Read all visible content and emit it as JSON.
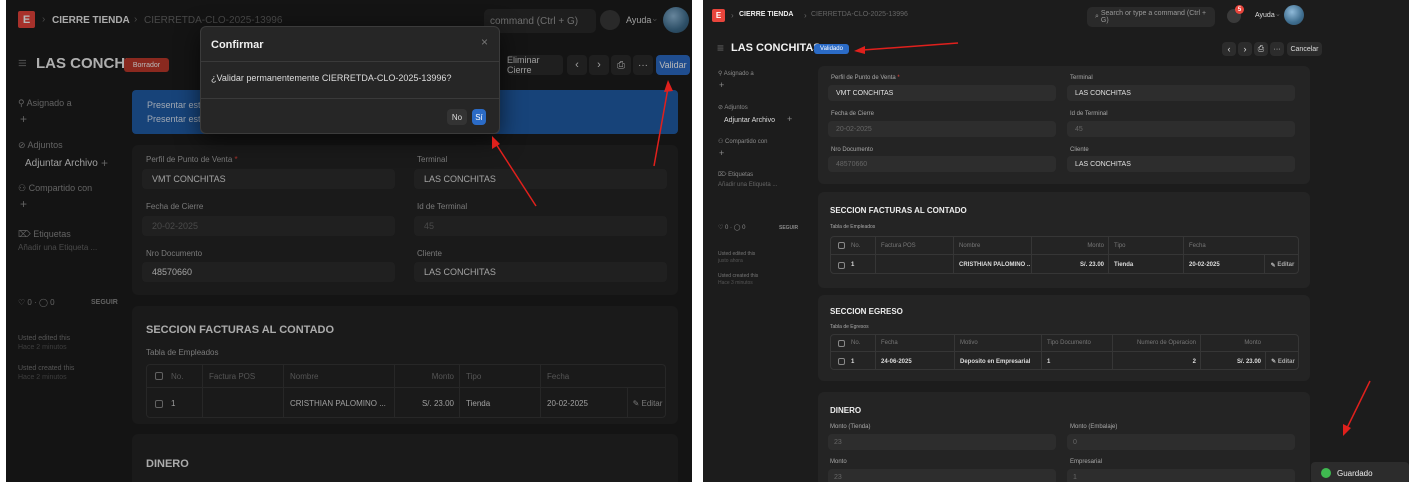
{
  "left": {
    "breadcrumb": {
      "module": "CIERRE TIENDA",
      "doc": "CIERRETDA-CLO-2025-13996"
    },
    "search_tail": "command (Ctrl + G)",
    "help": "Ayuda",
    "title": "LAS CONCHITAS",
    "status": "Borrador",
    "btn_eliminar": "Eliminar Cierre",
    "btn_validar": "Validar",
    "banner": {
      "line1": "Presentar este d",
      "line2": "Presentar este d"
    },
    "sidebar": {
      "assigned": "Asignado a",
      "attachments": "Adjuntos",
      "attach_btn": "Adjuntar Archivo",
      "shared": "Compartido con",
      "tags": "Etiquetas",
      "add_tag": "Añadir una Etiqueta ...",
      "likes": "0",
      "comments": "0",
      "follow": "SEGUIR",
      "activity1": "Usted edited this",
      "activity1_time": "Hace 2 minutos",
      "activity2": "Usted created this",
      "activity2_time": "Hace 2 minutos"
    },
    "fields": {
      "pdv_label": "Perfil de Punto de Venta",
      "pdv_value": "VMT CONCHITAS",
      "terminal_label": "Terminal",
      "terminal_value": "LAS CONCHITAS",
      "fecha_label": "Fecha de Cierre",
      "fecha_value": "20-02-2025",
      "idterm_label": "Id de Terminal",
      "idterm_value": "45",
      "nro_label": "Nro Documento",
      "nro_value": "48570660",
      "cliente_label": "Cliente",
      "cliente_value": "LAS CONCHITAS"
    },
    "section_facturas": "SECCION FACTURAS AL CONTADO",
    "tabla_empleados": "Tabla de Empleados",
    "table": {
      "headers": [
        "No.",
        "Factura POS",
        "Nombre",
        "Monto",
        "Tipo",
        "Fecha"
      ],
      "row": {
        "no": "1",
        "factura": "",
        "nombre": "CRISTHIAN PALOMINO ...",
        "monto": "S/. 23.00",
        "tipo": "Tienda",
        "fecha": "20-02-2025",
        "edit": "Editar"
      }
    },
    "section_dinero": "DINERO",
    "modal": {
      "title": "Confirmar",
      "message": "¿Validar permanentemente CIERRETDA-CLO-2025-13996?",
      "no": "No",
      "yes": "Sí",
      "close": "×"
    }
  },
  "right": {
    "breadcrumb": {
      "module": "CIERRE TIENDA",
      "doc": "CIERRETDA-CLO-2025-13996"
    },
    "search": "Search or type a command (Ctrl + G)",
    "notif_count": "5",
    "help": "Ayuda",
    "title": "LAS CONCHITAS",
    "status": "Validado",
    "btn_cancel": "Cancelar",
    "sidebar": {
      "assigned": "Asignado a",
      "attachments": "Adjuntos",
      "attach_btn": "Adjuntar Archivo",
      "shared": "Compartido con",
      "tags": "Etiquetas",
      "add_tag": "Añadir una Etiqueta ...",
      "likes": "0",
      "comments": "0",
      "follow": "SEGUIR",
      "activity1": "Usted edited this",
      "activity1_time": "justo ahora",
      "activity2": "Usted created this",
      "activity2_time": "Hace 3 minutos"
    },
    "fields": {
      "pdv_label": "Perfil de Punto de Venta",
      "pdv_value": "VMT CONCHITAS",
      "terminal_label": "Terminal",
      "terminal_value": "LAS CONCHITAS",
      "fecha_label": "Fecha de Cierre",
      "fecha_value": "20-02-2025",
      "idterm_label": "Id de Terminal",
      "idterm_value": "45",
      "nro_label": "Nro Documento",
      "nro_value": "48570660",
      "cliente_label": "Cliente",
      "cliente_value": "LAS CONCHITAS"
    },
    "section_facturas": "SECCION FACTURAS AL CONTADO",
    "tabla_empleados": "Tabla de Empleados",
    "table1": {
      "headers": [
        "No.",
        "Factura POS",
        "Nombre",
        "Monto",
        "Tipo",
        "Fecha"
      ],
      "row": {
        "no": "1",
        "factura": "",
        "nombre": "CRISTHIAN PALOMINO ...",
        "monto": "S/. 23.00",
        "tipo": "Tienda",
        "fecha": "20-02-2025",
        "edit": "Editar"
      }
    },
    "section_egreso": "SECCION EGRESO",
    "tabla_egresos": "Tabla de Egresos",
    "table2": {
      "headers": [
        "No.",
        "Fecha",
        "Motivo",
        "Tipo Documento",
        "Numero de Operacion",
        "Monto"
      ],
      "row": {
        "no": "1",
        "fecha": "24-06-2025",
        "motivo": "Deposito en Empresarial",
        "tipo": "1",
        "numero": "2",
        "monto": "S/. 23.00",
        "edit": "Editar"
      }
    },
    "section_dinero": "DINERO",
    "dinero": {
      "monto_tienda_label": "Monto (Tienda)",
      "monto_tienda_value": "23",
      "monto_embalaje_label": "Monto (Embalaje)",
      "monto_embalaje_value": "0",
      "monto_label": "Monto",
      "monto_value": "23",
      "empresarial_label": "Empresarial",
      "empresarial_value": "1"
    },
    "toast": "Guardado"
  },
  "colors": {
    "accent": "#2b6bc6",
    "danger": "#e8453c",
    "success": "#3fb950",
    "arrow": "#e0201c"
  }
}
